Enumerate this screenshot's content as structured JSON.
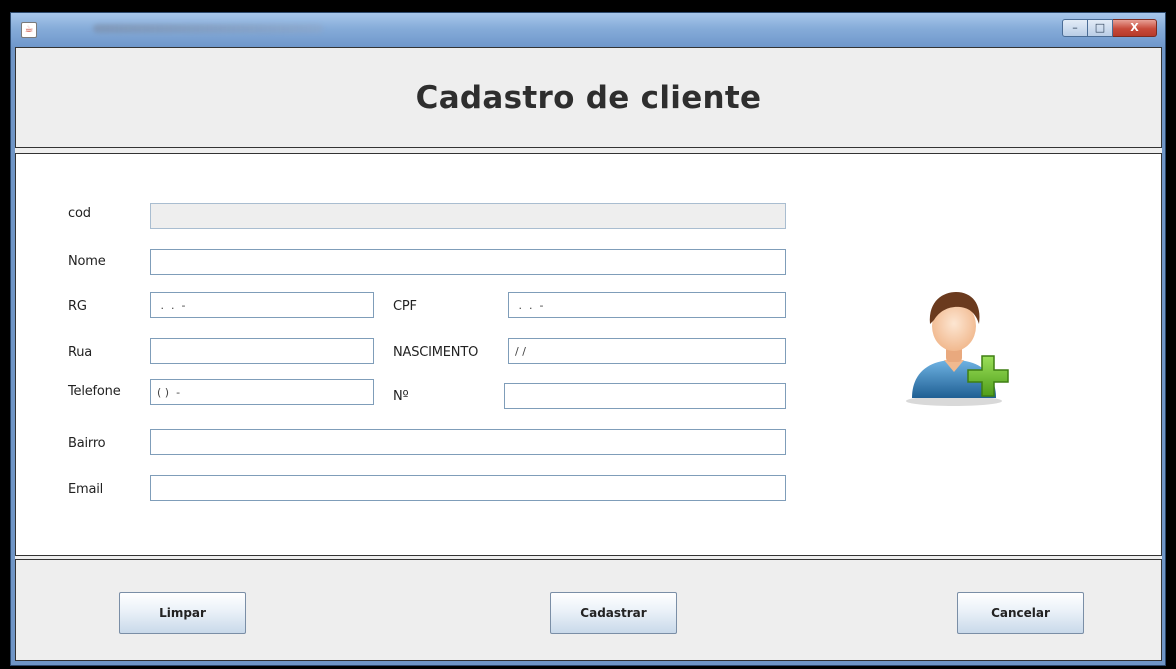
{
  "window": {
    "icon": "java-cup-icon",
    "controls": {
      "minimize": "–",
      "maximize": "□",
      "close": "X"
    }
  },
  "header": {
    "title": "Cadastro de cliente"
  },
  "form": {
    "cod": {
      "label": "cod",
      "value": ""
    },
    "nome": {
      "label": "Nome",
      "value": ""
    },
    "rg": {
      "label": "RG",
      "value": " .  .  -"
    },
    "cpf": {
      "label": "CPF",
      "value": " .  .  -"
    },
    "rua": {
      "label": "Rua",
      "value": ""
    },
    "nascimento": {
      "label": "NASCIMENTO",
      "value": "/ /"
    },
    "telefone": {
      "label": "Telefone",
      "value": "( )  -"
    },
    "numero": {
      "label": "Nº",
      "value": ""
    },
    "bairro": {
      "label": "Bairro",
      "value": ""
    },
    "email": {
      "label": "Email",
      "value": ""
    }
  },
  "avatar": {
    "icon": "add-user-icon"
  },
  "footer": {
    "limpar": "Limpar",
    "cadastrar": "Cadastrar",
    "cancelar": "Cancelar"
  },
  "colors": {
    "title_bar": "#86acd9",
    "panel_bg": "#eeeeee",
    "form_bg": "#ffffff",
    "field_border": "#7f9db9",
    "avatar_shirt": "#2f7fb8",
    "avatar_plus": "#6cbf2a"
  }
}
